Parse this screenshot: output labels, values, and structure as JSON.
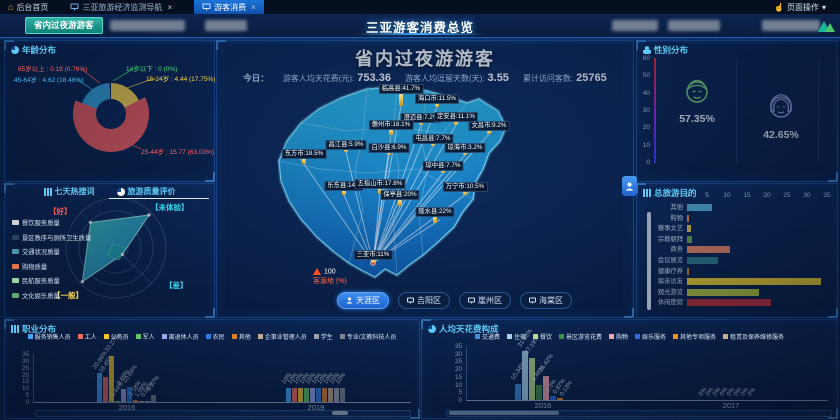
{
  "top_bar": {
    "home_label": "后台首页",
    "nav_tab": "三亚旅游经济监测导航",
    "active_tab": "游客消费",
    "close_glyph": "×",
    "page_ops_label": "页面操作",
    "page_ops_caret": "▾"
  },
  "sub_bar": {
    "active_tab": "省内过夜游游客",
    "page_title": "三亚游客消费总览"
  },
  "age_panel": {
    "title": "年龄分布",
    "chart_data": {
      "type": "pie",
      "labels": [
        "14岁以下",
        "15-24岁",
        "25-44岁",
        "45-64岁",
        "65岁以上"
      ],
      "values": [
        0,
        4.44,
        15.77,
        4.62,
        0.19
      ],
      "percent_labels": [
        "0%",
        "17.75%",
        "63.03%",
        "18.46%",
        "0.76%"
      ],
      "colors": [
        "#43d97c",
        "#ffd84d",
        "#f35d5d",
        "#38a8e0",
        "#ff8a65"
      ]
    },
    "callouts": [
      {
        "text": "65岁以上 : 0.19 (0.76%)",
        "color": "#ff6262"
      },
      {
        "text": "45-64岁 : 4.62 (18.46%)",
        "color": "#45b9f2"
      },
      {
        "text": "14岁以下 : 0 (0%)",
        "color": "#43d97c"
      },
      {
        "text": "15-24岁 : 4.44 (17.75%)",
        "color": "#ffd84d"
      },
      {
        "text": "25-44岁 : 15.77 (63.03%)",
        "color": "#ff6262"
      }
    ]
  },
  "quality_panel": {
    "tabs": [
      {
        "label": "七天热搜词",
        "active": false
      },
      {
        "label": "旅游质量评价",
        "active": true
      }
    ],
    "corners": {
      "top_left": "【好】",
      "top_right": "【未体验】",
      "bottom_right": "【差】",
      "bottom_left": "【一般】"
    },
    "legend": [
      {
        "label": "餐饮服务质量",
        "color": "#cfd4da"
      },
      {
        "label": "景区秩序与厕所卫生质量",
        "color": "#27435f"
      },
      {
        "label": "交通状况质量",
        "color": "#4d93a8"
      },
      {
        "label": "购物质量",
        "color": "#e2754e"
      },
      {
        "label": "民航服务质量",
        "color": "#9ed0a5"
      },
      {
        "label": "文化娱乐质量",
        "color": "#5ea86f"
      }
    ],
    "chart_data": {
      "type": "radar",
      "axes": [
        "好",
        "未体验",
        "差",
        "一般"
      ]
    }
  },
  "map_panel": {
    "headline": "省内过夜游游客",
    "today_label": "今日：",
    "stats": [
      {
        "label": "游客人均天花费(元):",
        "value": "753.36"
      },
      {
        "label": "游客人均逗留天数(天):",
        "value": "3.55"
      },
      {
        "label": "累计访问客数:",
        "value": "25765"
      }
    ],
    "legend": {
      "max": "100",
      "label": "客源地 (%)"
    },
    "chart_data": {
      "type": "map",
      "cities": [
        {
          "name": "临高县",
          "pct": "41.7%",
          "value": 41.7,
          "x": 184,
          "y": 65
        },
        {
          "name": "海口市",
          "pct": "11.5%",
          "value": 11.5,
          "x": 220,
          "y": 66
        },
        {
          "name": "澄迈县",
          "pct": "7.2%",
          "value": 7.2,
          "x": 204,
          "y": 84
        },
        {
          "name": "定安县",
          "pct": "11.1%",
          "value": 11.1,
          "x": 239,
          "y": 84
        },
        {
          "name": "儋州市",
          "pct": "18.1%",
          "value": 18.1,
          "x": 174,
          "y": 94
        },
        {
          "name": "文昌市",
          "pct": "9.2%",
          "value": 9.2,
          "x": 272,
          "y": 93
        },
        {
          "name": "屯昌县",
          "pct": "7.7%",
          "value": 7.7,
          "x": 216,
          "y": 105
        },
        {
          "name": "昌江县",
          "pct": "5.9%",
          "value": 5.9,
          "x": 129,
          "y": 111
        },
        {
          "name": "白沙县",
          "pct": "6.9%",
          "value": 6.9,
          "x": 172,
          "y": 114
        },
        {
          "name": "琼海市",
          "pct": "3.2%",
          "value": 3.2,
          "x": 248,
          "y": 114
        },
        {
          "name": "东方市",
          "pct": "18.5%",
          "value": 18.5,
          "x": 87,
          "y": 123
        },
        {
          "name": "琼中县",
          "pct": "7.7%",
          "value": 7.7,
          "x": 226,
          "y": 132
        },
        {
          "name": "乐东县",
          "pct": "14%",
          "value": 14,
          "x": 127,
          "y": 154
        },
        {
          "name": "五指山市",
          "pct": "17.8%",
          "value": 17.8,
          "x": 163,
          "y": 153
        },
        {
          "name": "万宁市",
          "pct": "10.5%",
          "value": 10.5,
          "x": 248,
          "y": 154
        },
        {
          "name": "保亭县",
          "pct": "20%",
          "value": 20,
          "x": 183,
          "y": 165
        },
        {
          "name": "陵水县",
          "pct": "22%",
          "value": 22,
          "x": 218,
          "y": 182
        },
        {
          "name": "三亚市",
          "pct": "11%",
          "value": 11,
          "x": 156,
          "y": 222
        }
      ]
    },
    "district_tabs": [
      {
        "label": "天涯区",
        "active": true
      },
      {
        "label": "吉阳区",
        "active": false
      },
      {
        "label": "崖州区",
        "active": false
      },
      {
        "label": "海棠区",
        "active": false
      }
    ]
  },
  "gender_panel": {
    "title": "性别分布",
    "y_ticks": [
      "60",
      "50",
      "40",
      "30",
      "20",
      "10",
      "0"
    ],
    "male": {
      "pct": "57.35%"
    },
    "female": {
      "pct": "42.65%"
    },
    "chart_data": {
      "type": "bar",
      "categories": [
        "男",
        "女"
      ],
      "values": [
        57.35,
        42.65
      ],
      "ylim": [
        0,
        60
      ]
    }
  },
  "purpose_panel": {
    "title": "总旅游目的",
    "chart_data": {
      "type": "bar",
      "orientation": "horizontal",
      "x_ticks": [
        "0",
        "5",
        "10",
        "15",
        "20",
        "25",
        "30",
        "35"
      ],
      "xlim": [
        0,
        35
      ],
      "categories": [
        "其他",
        "购物",
        "赛事文艺",
        "宗教朝拜",
        "商务",
        "会议展览",
        "健康疗养",
        "探亲访友",
        "观光游览",
        "休闲度假"
      ],
      "values": [
        6.2,
        0.6,
        1,
        1.2,
        10.8,
        7.8,
        0.6,
        33.5,
        18,
        21
      ],
      "colors": [
        "#58b7d9",
        "#e8973d",
        "#efc93f",
        "#6fae44",
        "#f28963",
        "#2f7f8e",
        "#e0812e",
        "#f6d32a",
        "#b9ca3c",
        "#c53038"
      ]
    }
  },
  "occupation_panel": {
    "title": "职业分布",
    "chart_data": {
      "type": "bar",
      "grouped": true,
      "y_ticks": [
        "35",
        "30",
        "25",
        "20",
        "15",
        "10",
        "5",
        "0"
      ],
      "ylim": [
        0,
        35
      ],
      "categories": [
        "2016",
        "2019"
      ],
      "series": [
        {
          "name": "服务销售人员",
          "color": "#45a5f5",
          "values": [
            20.88,
            10
          ],
          "labels": [
            "20.88%",
            "10%"
          ]
        },
        {
          "name": "工人",
          "color": "#f06d65",
          "values": [
            18.45,
            10
          ],
          "labels": [
            "18.45%",
            "10%"
          ]
        },
        {
          "name": "公务员",
          "color": "#f5c62c",
          "values": [
            33.27,
            10
          ],
          "labels": [
            "33.27%",
            "10%"
          ]
        },
        {
          "name": "军人",
          "color": "#61c26a",
          "values": [
            0.44,
            10
          ],
          "labels": [
            "0.44%",
            "10%"
          ]
        },
        {
          "name": "离退休人员",
          "color": "#9aa6e8",
          "values": [
            9.69,
            10
          ],
          "labels": [
            "9.69%",
            "10%"
          ]
        },
        {
          "name": "农民",
          "color": "#2f7de0",
          "values": [
            10.69,
            10
          ],
          "labels": [
            "10.69%",
            "10%"
          ]
        },
        {
          "name": "其他",
          "color": "#d8822a",
          "values": [
            1.18,
            10
          ],
          "labels": [
            "1.18%",
            "10%"
          ]
        },
        {
          "name": "企事业管理人员",
          "color": "#bfa894",
          "values": [
            1.09,
            10
          ],
          "labels": [
            "1.09%",
            "10%"
          ]
        },
        {
          "name": "学生",
          "color": "#9aa2ab",
          "values": [
            0.58,
            10
          ],
          "labels": [
            "0.58%",
            "10%"
          ]
        },
        {
          "name": "专业/文教科技人员",
          "color": "#7d878f",
          "values": [
            5.27,
            10
          ],
          "labels": [
            "5.27%",
            "10%"
          ]
        }
      ]
    }
  },
  "spending_panel": {
    "title": "人均天花费构成",
    "chart_data": {
      "type": "bar",
      "grouped": true,
      "y_ticks": [
        "35",
        "30",
        "25",
        "20",
        "15",
        "10",
        "5",
        "0"
      ],
      "ylim": [
        0,
        35
      ],
      "categories": [
        "2016",
        "2017"
      ],
      "series": [
        {
          "name": "交通费",
          "color": "#3f8fd8",
          "values": [
            10.34,
            0
          ],
          "labels": [
            "10.34%",
            "0%"
          ]
        },
        {
          "name": "住宿",
          "color": "#a9d3ea",
          "values": [
            31.65,
            0
          ],
          "labels": [
            "31.65%",
            "0%"
          ]
        },
        {
          "name": "餐饮",
          "color": "#b8dc8a",
          "values": [
            27.19,
            0
          ],
          "labels": [
            "27.19%",
            "0%"
          ]
        },
        {
          "name": "景区游览花费",
          "color": "#3f9146",
          "values": [
            9.46,
            0
          ],
          "labels": [
            "9.46%",
            "0%"
          ]
        },
        {
          "name": "购物",
          "color": "#f4a6ad",
          "values": [
            15.42,
            0
          ],
          "labels": [
            "15.42%",
            "0%"
          ]
        },
        {
          "name": "娱乐服务",
          "color": "#2e6de0",
          "values": [
            2.3,
            0
          ],
          "labels": [
            "2.3%",
            "0%"
          ]
        },
        {
          "name": "其他专项服务",
          "color": "#ef9222",
          "values": [
            0.97,
            0
          ],
          "labels": [
            "0.97%",
            "0%"
          ]
        },
        {
          "name": "租赁及保养维修服务",
          "color": "#cbab89",
          "values": [
            0.13,
            0
          ],
          "labels": [
            "0.13%",
            "0%"
          ]
        }
      ]
    }
  }
}
